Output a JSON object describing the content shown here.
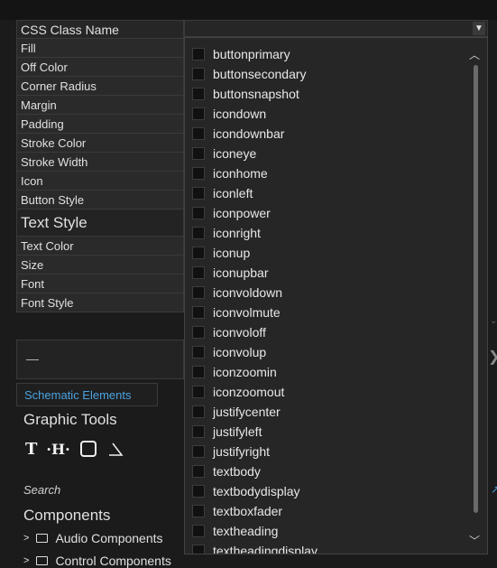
{
  "properties": {
    "header": "CSS Class Name",
    "rows": [
      "Fill",
      "Off Color",
      "Corner Radius",
      "Margin",
      "Padding",
      "Stroke Color",
      "Stroke Width",
      "Icon",
      "Button Style"
    ],
    "section": "Text Style",
    "text_rows": [
      "Text Color",
      "Size",
      "Font",
      "Font Style"
    ]
  },
  "lower": {
    "dash": "—",
    "schematic_tab": "Schematic Elements",
    "graphic_tools": "Graphic Tools",
    "search_placeholder": "Search",
    "components_title": "Components",
    "tree": [
      "Audio Components",
      "Control Components"
    ]
  },
  "dropdown": {
    "items": [
      "buttonprimary",
      "buttonsecondary",
      "buttonsnapshot",
      "icondown",
      "icondownbar",
      "iconeye",
      "iconhome",
      "iconleft",
      "iconpower",
      "iconright",
      "iconup",
      "iconupbar",
      "iconvoldown",
      "iconvolmute",
      "iconvoloff",
      "iconvolup",
      "iconzoomin",
      "iconzoomout",
      "justifycenter",
      "justifyleft",
      "justifyright",
      "textbody",
      "textbodydisplay",
      "textboxfader",
      "textheading",
      "textheadingdisplay"
    ]
  },
  "colors": {
    "accent": "#4aa3e0",
    "background": "#1b1b1b"
  }
}
